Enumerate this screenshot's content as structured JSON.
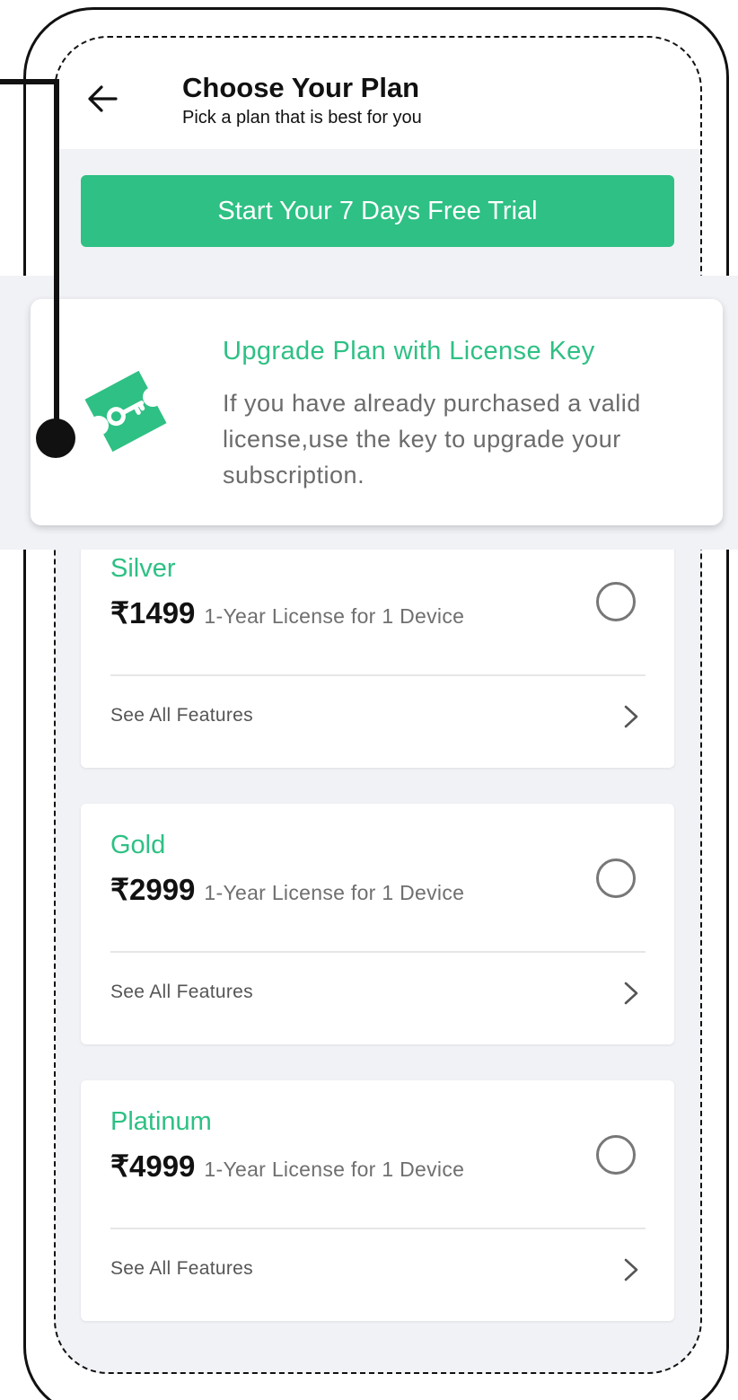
{
  "header": {
    "title": "Choose Your Plan",
    "subtitle": "Pick a plan that is best for you"
  },
  "trial_button": {
    "label": "Start Your 7 Days Free Trial"
  },
  "license": {
    "title": "Upgrade Plan with License Key",
    "description": "If you have already purchased a valid license,use the key to upgrade your subscription.",
    "icon": "license-ticket-key-icon"
  },
  "plans": [
    {
      "name": "Silver",
      "price": "₹1499",
      "description": "1-Year License for 1 Device",
      "features_label": "See All Features",
      "selected": false
    },
    {
      "name": "Gold",
      "price": "₹2999",
      "description": "1-Year License for 1 Device",
      "features_label": "See All Features",
      "selected": false
    },
    {
      "name": "Platinum",
      "price": "₹4999",
      "description": "1-Year License for 1 Device",
      "features_label": "See All Features",
      "selected": false
    }
  ],
  "colors": {
    "accent": "#2ec084",
    "background": "#f1f2f6",
    "card": "#ffffff"
  }
}
